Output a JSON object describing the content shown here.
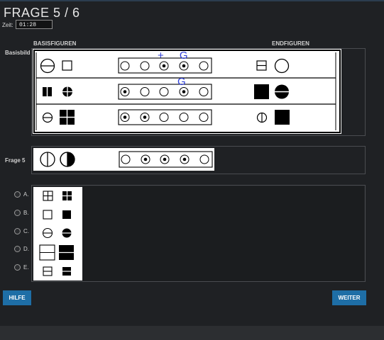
{
  "header": {
    "title": "FRAGE 5 / 6",
    "timer_label": "Zeit:",
    "timer_value": "01:28"
  },
  "columns": {
    "basis": "BASISFIGUREN",
    "end": "ENDFIGUREN"
  },
  "labels": {
    "basisbild": "Basisbild",
    "frage": "Frage 5"
  },
  "annotations": {
    "row1": "+ G",
    "row2": "G"
  },
  "options": [
    {
      "label": "A."
    },
    {
      "label": "B."
    },
    {
      "label": "C."
    },
    {
      "label": "D."
    },
    {
      "label": "E."
    }
  ],
  "buttons": {
    "help": "HILFE",
    "next": "WEITER"
  },
  "colors": {
    "background": "#1f2124",
    "button": "#1e6ea6",
    "annotation": "#2f3fd8"
  }
}
